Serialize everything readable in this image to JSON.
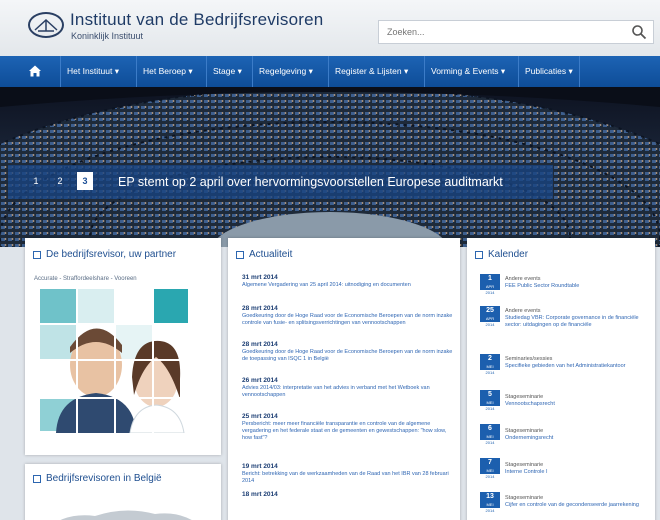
{
  "header": {
    "title": "Instituut van de Bedrijfsrevisoren",
    "subtitle": "Koninklijk Instituut",
    "search_placeholder": "Zoeken...",
    "logo_text": "IBR"
  },
  "nav": {
    "items": [
      {
        "label": "Het Instituut ▾"
      },
      {
        "label": "Het Beroep ▾"
      },
      {
        "label": "Stage ▾"
      },
      {
        "label": "Regelgeving ▾"
      },
      {
        "label": "Register & Lijsten ▾"
      },
      {
        "label": "Vorming & Events ▾"
      },
      {
        "label": "Publicaties ▾"
      }
    ]
  },
  "hero": {
    "slides": [
      "1",
      "2",
      "3"
    ],
    "active_slide": "3",
    "caption": "EP stemt op 2 april over hervormingsvoorstellen Europese auditmarkt"
  },
  "panels": {
    "partner": {
      "title": "De bedrijfsrevisor, uw partner",
      "breadcrumb": "Accurate - Straffordeelshare - Vooreen"
    },
    "belgie": {
      "title": "Bedrijfsrevisoren in België"
    },
    "actualiteit": {
      "title": "Actualiteit",
      "items": [
        {
          "date": "31 mrt 2014",
          "text": "Algemene Vergadering van 25 april 2014: uitnodiging en documenten"
        },
        {
          "date": "28 mrt 2014",
          "text": "Goedkeuring door de Hoge Raad voor de Economische Beroepen van de norm inzake controle van fusie- en splitsingsverrichtingen van vennootschappen"
        },
        {
          "date": "28 mrt 2014",
          "text": "Goedkeuring door de Hoge Raad voor de Economische Beroepen van de norm inzake de toepassing van ISQC 1 in België"
        },
        {
          "date": "26 mrt 2014",
          "text": "Advies 2014/03: interpretatie van het advies in verband met het Wetboek van vennootschappen"
        },
        {
          "date": "25 mrt 2014",
          "text": "Persbericht: meer meer financiële transparantie en controle van de algemene vergadering en het federale staat en de gemeenten en gewestschappen: \"how slow, how fast\"?"
        },
        {
          "date": "19 mrt 2014",
          "text": "Bericht: betrekking van de werkzaamheden van de Raad van het IBR van 28 februari 2014"
        },
        {
          "date": "18 mrt 2014",
          "text": ""
        }
      ]
    },
    "kalender": {
      "title": "Kalender",
      "items": [
        {
          "day": "1",
          "month": "APR",
          "year": "2014",
          "category": "Andere events",
          "title": "FEE Public Sector Roundtable"
        },
        {
          "day": "25",
          "month": "APR",
          "year": "2014",
          "category": "Andere events",
          "title": "Studiedag VBR: Corporate governance in de financiële sector: uitdagingen op de financiële"
        },
        {
          "day": "2",
          "month": "MEI",
          "year": "2014",
          "category": "Seminaries/sessies",
          "title": "Specifieke gebieden van het Administratiekantoor"
        },
        {
          "day": "5",
          "month": "MEI",
          "year": "2014",
          "category": "Stageseminarie",
          "title": "Vennootschapsrecht"
        },
        {
          "day": "6",
          "month": "MEI",
          "year": "2014",
          "category": "Stageseminarie",
          "title": "Ondernemingsrecht"
        },
        {
          "day": "7",
          "month": "MEI",
          "year": "2014",
          "category": "Stageseminarie",
          "title": "Interne Controle I"
        },
        {
          "day": "13",
          "month": "MEI",
          "year": "2014",
          "category": "Stageseminarie",
          "title": "Cijfer en controle van de gecondenseerde jaarrekening"
        }
      ]
    }
  },
  "colors": {
    "nav_blue": "#1d63b4",
    "title_blue": "#1f3b66",
    "link_blue": "#2f66b3",
    "badge_blue": "#1c5fae"
  }
}
